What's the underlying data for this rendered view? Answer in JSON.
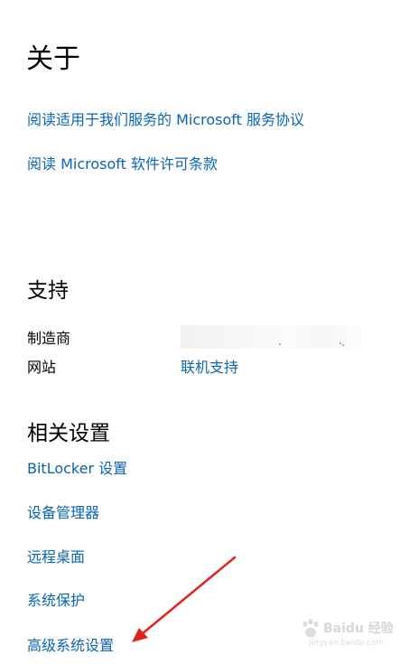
{
  "colors": {
    "link": "#0a64b4",
    "heading": "#000000",
    "arrow": "#e3231b"
  },
  "about": {
    "title": "关于",
    "links": [
      "阅读适用于我们服务的 Microsoft 服务协议",
      "阅读 Microsoft 软件许可条款"
    ]
  },
  "support": {
    "title": "支持",
    "manufacturer_label": "制造商",
    "website_label": "网站",
    "website_link": "联机支持"
  },
  "related": {
    "title": "相关设置",
    "links": [
      "BitLocker 设置",
      "设备管理器",
      "远程桌面",
      "系统保护",
      "高级系统设置"
    ]
  },
  "annotation": {
    "arrow_icon": "red-arrow-icon"
  },
  "watermark": {
    "text": "Baidu 经验",
    "sub": "jingyan.baidu.com"
  }
}
